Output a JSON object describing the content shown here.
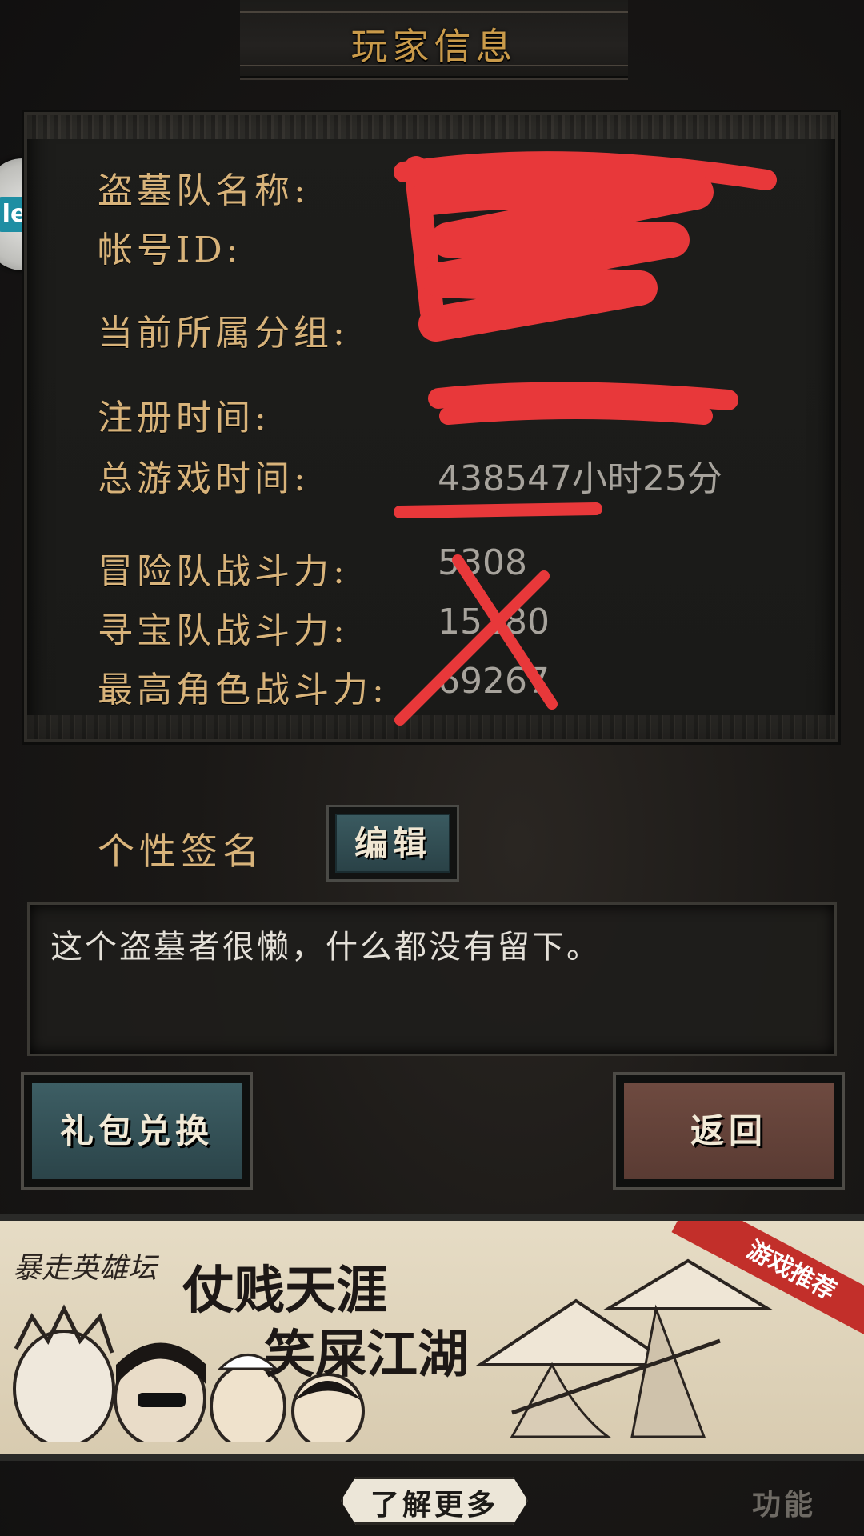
{
  "header": {
    "title": "玩家信息"
  },
  "side_badge": {
    "glyph": "le"
  },
  "info": {
    "rows": [
      {
        "label": "盗墓队名称:",
        "value": ""
      },
      {
        "label": "帐号ID:",
        "value": ""
      },
      {
        "label": "当前所属分组:",
        "value": ""
      },
      {
        "label": "注册时间:",
        "value": ""
      },
      {
        "label": "总游戏时间:",
        "value": "438547小时25分"
      },
      {
        "label": "冒险队战斗力:",
        "value": "5308"
      },
      {
        "label": "寻宝队战斗力:",
        "value": "15180"
      },
      {
        "label": "最高角色战斗力:",
        "value": "69267"
      }
    ]
  },
  "signature": {
    "label": "个性签名",
    "edit_label": "编辑",
    "text": "这个盗墓者很懒，什么都没有留下。"
  },
  "buttons": {
    "gift": "礼包兑换",
    "back": "返回"
  },
  "banner": {
    "forum": "暴走英雄坛",
    "line1": "仗贱天涯",
    "line2": "笑屎江湖",
    "ribbon": "游戏推荐"
  },
  "footer": {
    "more": "了解更多",
    "function": "功能"
  },
  "colors": {
    "label_gold": "#d8b37a",
    "value_gray": "#a7a39c",
    "redact_red": "#e8383a",
    "button_teal": "#3d5e64",
    "button_brown": "#6e4a40"
  }
}
